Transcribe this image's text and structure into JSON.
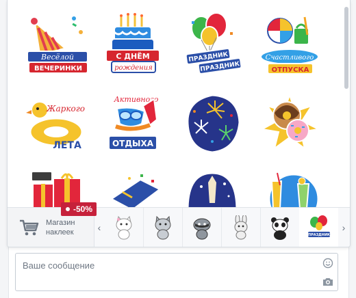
{
  "sticker_grid": {
    "rows": [
      [
        {
          "name": "party-hat-sticker",
          "line1": "Весёлой",
          "line2": "ВЕЧЕРИНКИ"
        },
        {
          "name": "birthday-cake-sticker",
          "line1": "С ДНЁМ",
          "line2": "рождения"
        },
        {
          "name": "balloons-holiday-sticker",
          "line1": "ПРАЗДНИК",
          "line2": "ПРАЗДНИК"
        },
        {
          "name": "beach-vacation-sticker",
          "line1": "Счастливого",
          "line2": "ОТПУСКА"
        }
      ],
      [
        {
          "name": "duck-float-sticker",
          "line1": "Жаркого",
          "line2": "ЛЕТА"
        },
        {
          "name": "active-rest-sticker",
          "line1": "Активного",
          "line2": "ОТДЫХА"
        },
        {
          "name": "fireworks-sticker",
          "line1": "",
          "line2": ""
        },
        {
          "name": "donut-sticker",
          "line1": "",
          "line2": ""
        }
      ],
      [
        {
          "name": "gift-box-sticker",
          "line1": "",
          "line2": ""
        },
        {
          "name": "hat-party-sticker",
          "line1": "",
          "line2": ""
        },
        {
          "name": "night-city-sticker",
          "line1": "",
          "line2": ""
        },
        {
          "name": "cocktail-sticker",
          "line1": "",
          "line2": ""
        }
      ]
    ]
  },
  "store": {
    "label_line1": "Магазин",
    "label_line2": "наклеек",
    "discount": "-50%"
  },
  "packs": [
    {
      "name": "white-cat-pack"
    },
    {
      "name": "grey-cat-pack"
    },
    {
      "name": "raccoon-pack"
    },
    {
      "name": "bunny-pack"
    },
    {
      "name": "panda-pack"
    },
    {
      "name": "holiday-pack",
      "active": true,
      "label": "ПРАЗДНИК"
    }
  ],
  "composer": {
    "placeholder": "Ваше сообщение"
  },
  "colors": {
    "accent": "#c6213b",
    "banner_blue": "#2b4fa8",
    "banner_red": "#d6262f",
    "orange": "#f49b1c"
  }
}
